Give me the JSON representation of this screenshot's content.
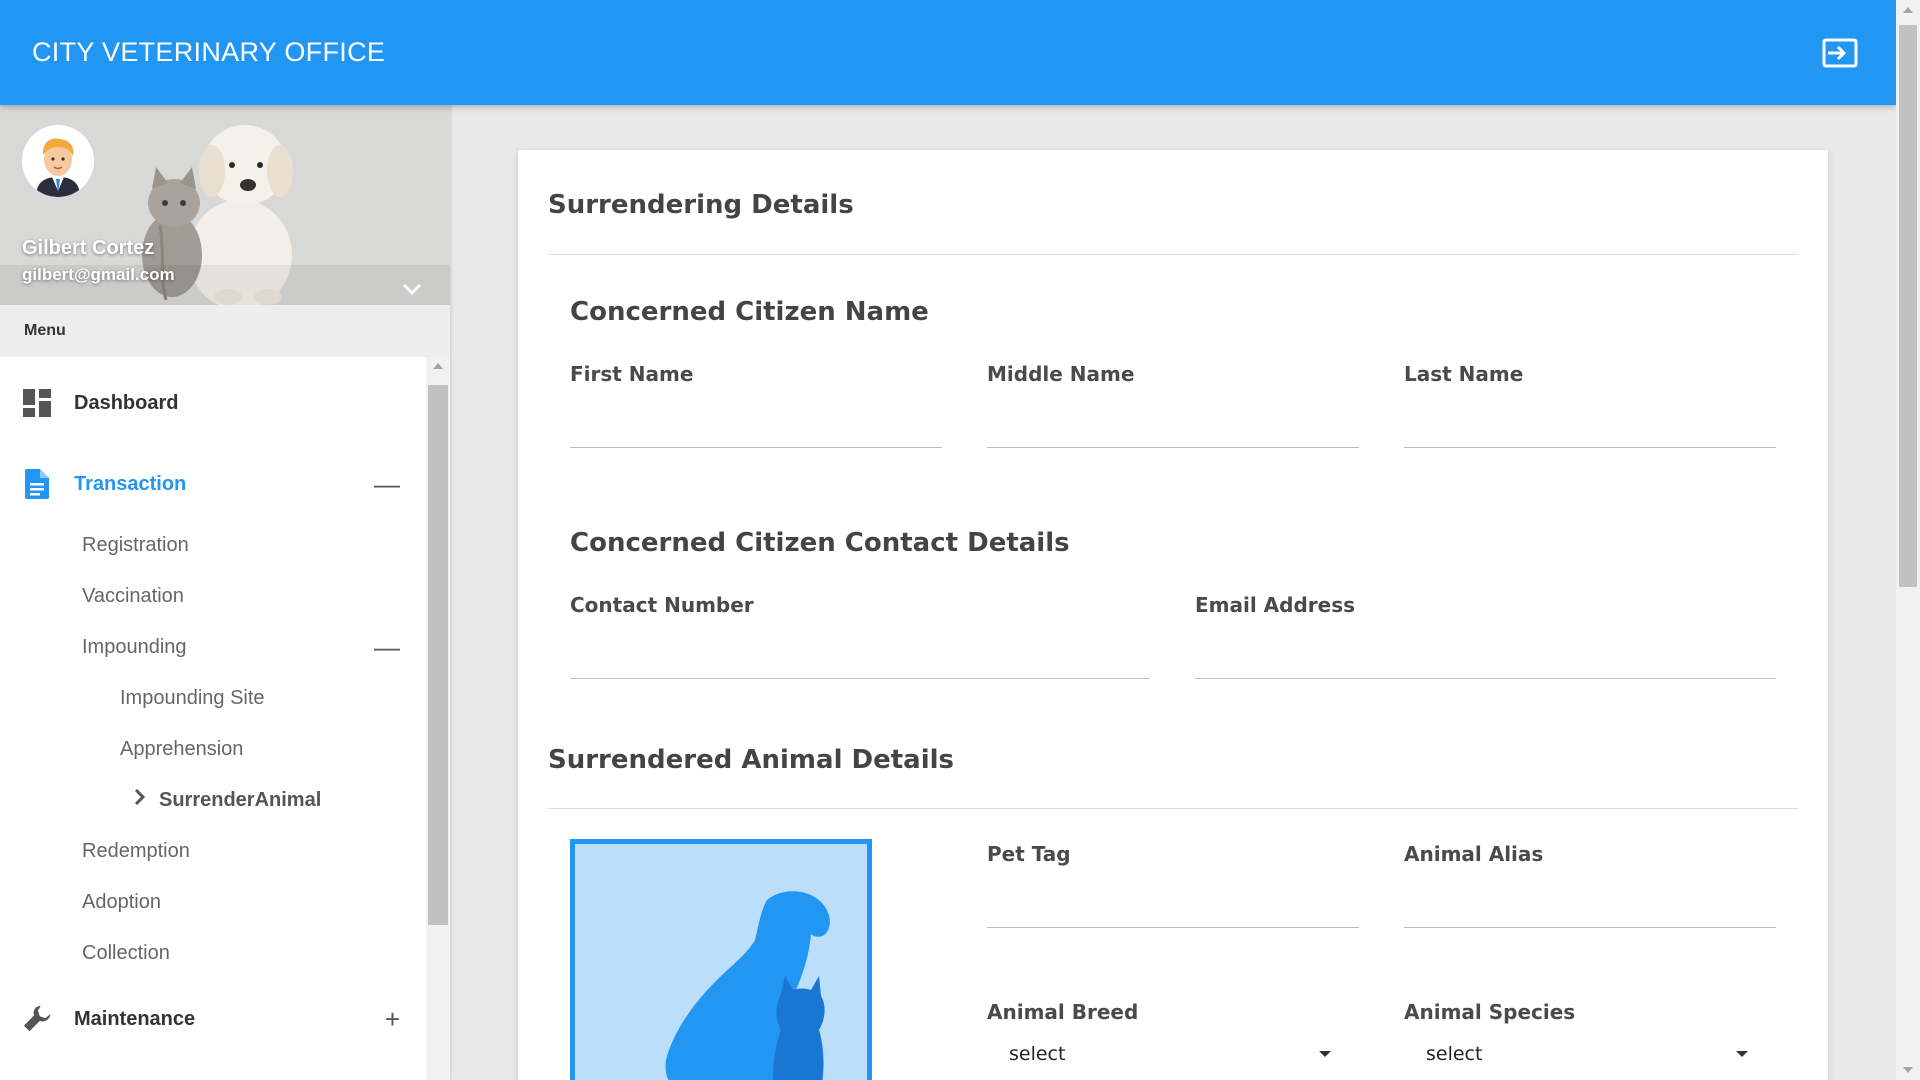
{
  "app": {
    "title": "CITY VETERINARY OFFICE"
  },
  "user": {
    "name": "Gilbert Cortez",
    "email": "gilbert@gmail.com"
  },
  "menu": {
    "header": "Menu",
    "items": [
      {
        "label": "Dashboard",
        "icon": "dashboard-icon"
      },
      {
        "label": "Transaction",
        "icon": "document-icon",
        "toggle": "—",
        "active": true
      },
      {
        "label": "Maintenance",
        "icon": "wrench-icon",
        "toggle": "+"
      }
    ],
    "transaction_sub": {
      "registration": "Registration",
      "vaccination": "Vaccination",
      "impounding": "Impounding",
      "impounding_toggle": "—",
      "impounding_site": "Impounding Site",
      "apprehension": "Apprehension",
      "surrender_animal": "SurrenderAnimal",
      "redemption": "Redemption",
      "adoption": "Adoption",
      "collection": "Collection"
    }
  },
  "form": {
    "title": "Surrendering Details",
    "citizen_name": {
      "heading": "Concerned Citizen Name",
      "first_name": {
        "label": "First Name",
        "value": ""
      },
      "middle_name": {
        "label": "Middle Name",
        "value": ""
      },
      "last_name": {
        "label": "Last Name",
        "value": ""
      }
    },
    "contact": {
      "heading": "Concerned Citizen Contact Details",
      "contact_number": {
        "label": "Contact Number",
        "value": ""
      },
      "email": {
        "label": "Email Address",
        "value": ""
      }
    },
    "animal": {
      "heading": "Surrendered Animal Details",
      "pet_tag": {
        "label": "Pet Tag",
        "value": ""
      },
      "alias": {
        "label": "Animal Alias",
        "value": ""
      },
      "breed": {
        "label": "Animal Breed",
        "selected": "select"
      },
      "species": {
        "label": "Animal Species",
        "selected": "select"
      }
    }
  },
  "colors": {
    "primary": "#2196f3",
    "photo_bg": "#bbdefb"
  }
}
